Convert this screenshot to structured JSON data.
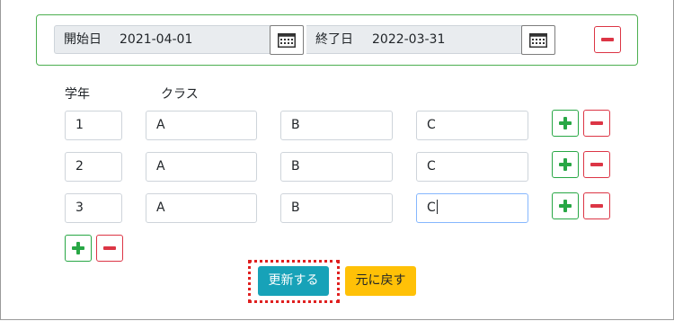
{
  "period": {
    "start_label": "開始日",
    "start_value": "2021-04-01",
    "end_label": "終了日",
    "end_value": "2022-03-31"
  },
  "table": {
    "headers": {
      "grade": "学年",
      "class": "クラス"
    },
    "rows": [
      {
        "grade": "1",
        "classes": [
          "A",
          "B",
          "C"
        ]
      },
      {
        "grade": "2",
        "classes": [
          "A",
          "B",
          "C"
        ]
      },
      {
        "grade": "3",
        "classes": [
          "A",
          "B",
          "C"
        ]
      }
    ]
  },
  "actions": {
    "update_label": "更新する",
    "revert_label": "元に戻す"
  },
  "colors": {
    "panel_border": "#4caf50",
    "danger": "#dc3545",
    "success": "#28a745",
    "info": "#17a2b8",
    "warning": "#ffc107",
    "highlight": "#e02020"
  },
  "icons": {
    "calendar": "calendar-icon",
    "minus": "minus-icon",
    "plus": "plus-icon"
  }
}
